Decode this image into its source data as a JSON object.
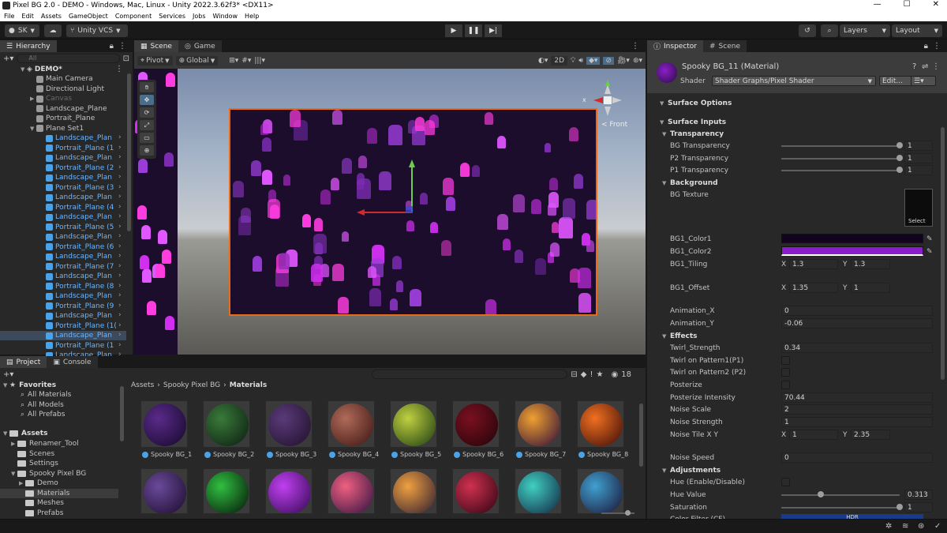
{
  "window": {
    "title": "Pixel BG 2.0 - DEMO - Windows, Mac, Linux - Unity 2022.3.62f3* <DX11>",
    "minimize": "—",
    "maximize": "☐",
    "close": "✕"
  },
  "menu": [
    "File",
    "Edit",
    "Assets",
    "GameObject",
    "Component",
    "Services",
    "Jobs",
    "Window",
    "Help"
  ],
  "toolbar": {
    "account": "SK",
    "vcs": "Unity VCS",
    "layers": "Layers",
    "layout": "Layout"
  },
  "hierarchy": {
    "tab": "Hierarchy",
    "search_placeholder": "All",
    "scene": "DEMO*",
    "items": [
      {
        "label": "Main Camera",
        "type": "gray"
      },
      {
        "label": "Directional Light",
        "type": "gray"
      },
      {
        "label": "Canvas",
        "type": "disabled"
      },
      {
        "label": "Landscape_Plane",
        "type": "gray"
      },
      {
        "label": "Portrait_Plane",
        "type": "gray"
      },
      {
        "label": "Plane Set1",
        "type": "gray"
      },
      {
        "label": "Landscape_Plan",
        "type": "blue"
      },
      {
        "label": "Portrait_Plane (1",
        "type": "blue"
      },
      {
        "label": "Landscape_Plan",
        "type": "blue"
      },
      {
        "label": "Portrait_Plane (2",
        "type": "blue"
      },
      {
        "label": "Landscape_Plan",
        "type": "blue"
      },
      {
        "label": "Portrait_Plane (3",
        "type": "blue"
      },
      {
        "label": "Landscape_Plan",
        "type": "blue"
      },
      {
        "label": "Portrait_Plane (4",
        "type": "blue"
      },
      {
        "label": "Landscape_Plan",
        "type": "blue"
      },
      {
        "label": "Portrait_Plane (5",
        "type": "blue"
      },
      {
        "label": "Landscape_Plan",
        "type": "blue"
      },
      {
        "label": "Portrait_Plane (6",
        "type": "blue"
      },
      {
        "label": "Landscape_Plan",
        "type": "blue"
      },
      {
        "label": "Portrait_Plane (7",
        "type": "blue"
      },
      {
        "label": "Landscape_Plan",
        "type": "blue"
      },
      {
        "label": "Portrait_Plane (8",
        "type": "blue"
      },
      {
        "label": "Landscape_Plan",
        "type": "blue"
      },
      {
        "label": "Portrait_Plane (9",
        "type": "blue"
      },
      {
        "label": "Landscape_Plan",
        "type": "blue"
      },
      {
        "label": "Portrait_Plane (1(",
        "type": "blue"
      },
      {
        "label": "Landscape_Plan",
        "type": "sel"
      },
      {
        "label": "Portrait_Plane (1",
        "type": "blue"
      },
      {
        "label": "Landscape_Plan",
        "type": "blue"
      }
    ]
  },
  "scene_tabs": [
    "Scene",
    "Game"
  ],
  "scene_toolbar": {
    "pivot": "Pivot",
    "global": "Global",
    "mode2d": "2D"
  },
  "gizmo": {
    "x": "x",
    "front": "< Front"
  },
  "inspector": {
    "tabs": [
      "Inspector",
      "Scene"
    ],
    "title": "Spooky BG_11 (Material)",
    "shader_label": "Shader",
    "shader": "Shader Graphs/Pixel Shader",
    "edit": "Edit...",
    "surface_options": "Surface Options",
    "surface_inputs": "Surface Inputs",
    "transparency": "Transparency",
    "bg_transparency": {
      "label": "BG Transparency",
      "value": "1"
    },
    "p2_transparency": {
      "label": "P2 Transparency",
      "value": "1"
    },
    "p1_transparency": {
      "label": "P1 Transparency",
      "value": "1"
    },
    "background": "Background",
    "bg_texture": "BG Texture",
    "select": "Select",
    "bg1_color1": {
      "label": "BG1_Color1",
      "color": "#12031f"
    },
    "bg1_color2": {
      "label": "BG1_Color2",
      "color": "#8a1fc9"
    },
    "bg1_tiling": {
      "label": "BG1_Tiling",
      "x": "1.3",
      "y": "1.3"
    },
    "bg1_offset": {
      "label": "BG1_Offset",
      "x": "1.35",
      "y": "1"
    },
    "animation_x": {
      "label": "Animation_X",
      "value": "0"
    },
    "animation_y": {
      "label": "Animation_Y",
      "value": "-0.06"
    },
    "effects": "Effects",
    "twirl_strength": {
      "label": "Twirl_Strength",
      "value": "0.34"
    },
    "twirl_p1": "Twirl on Pattern1(P1)",
    "twirl_p2": "Twirl on Pattern2 (P2)",
    "posterize": "Posterize",
    "posterize_intensity": {
      "label": "Posterize Intensity",
      "value": "70.44"
    },
    "noise_scale": {
      "label": "Noise Scale",
      "value": "2"
    },
    "noise_strength": {
      "label": "Noise Strength",
      "value": "1"
    },
    "noise_tile": {
      "label": "Noise Tile X Y",
      "x": "1",
      "y": "2.35"
    },
    "noise_speed": {
      "label": "Noise Speed",
      "value": "0"
    },
    "adjustments": "Adjustments",
    "hue_enable": "Hue (Enable/Disable)",
    "hue_value": {
      "label": "Hue Value",
      "value": "0.313",
      "fraction": 0.313
    },
    "saturation": {
      "label": "Saturation",
      "value": "1"
    },
    "color_filter": {
      "label": "Color Filter (CF)",
      "badge": "HDR"
    },
    "x": "X",
    "y": "Y"
  },
  "project": {
    "tabs": [
      "Project",
      "Console"
    ],
    "count": "18",
    "favorites": "Favorites",
    "fav_items": [
      "All Materials",
      "All Models",
      "All Prefabs"
    ],
    "assets": "Assets",
    "asset_items": [
      {
        "label": "Renamer_Tool",
        "depth": 1
      },
      {
        "label": "Scenes",
        "depth": 1
      },
      {
        "label": "Settings",
        "depth": 1
      },
      {
        "label": "Spooky Pixel BG",
        "depth": 1
      },
      {
        "label": "Demo",
        "depth": 2
      },
      {
        "label": "Materials",
        "depth": 2
      },
      {
        "label": "Meshes",
        "depth": 2
      },
      {
        "label": "Prefabs",
        "depth": 2
      }
    ],
    "breadcrumb": [
      "Assets",
      "Spooky Pixel BG",
      "Materials"
    ],
    "materials": [
      "Spooky BG_1",
      "Spooky BG_2",
      "Spooky BG_3",
      "Spooky BG_4",
      "Spooky BG_5",
      "Spooky BG_6",
      "Spooky BG_7",
      "Spooky BG_8"
    ]
  }
}
